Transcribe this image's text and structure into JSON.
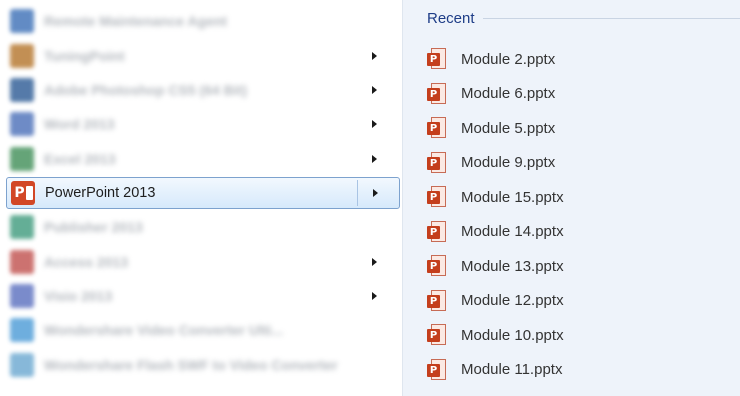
{
  "programs": [
    {
      "label": "Remote Maintenance Agent",
      "icon": "agent-icon",
      "color": "#3b6fb6",
      "has_submenu": false,
      "blurred": true
    },
    {
      "label": "TuningPoint",
      "icon": "turningpoint-icon",
      "color": "#b4742a",
      "has_submenu": true,
      "blurred": true
    },
    {
      "label": "Adobe Photoshop CS5 (64 Bit)",
      "icon": "photoshop-icon",
      "color": "#2b5a94",
      "has_submenu": true,
      "blurred": true
    },
    {
      "label": "Word 2013",
      "icon": "word-icon",
      "color": "#4a6fb8",
      "has_submenu": true,
      "blurred": true
    },
    {
      "label": "Excel 2013",
      "icon": "excel-icon",
      "color": "#3f8e57",
      "has_submenu": true,
      "blurred": true
    },
    {
      "label": "PowerPoint 2013",
      "icon": "powerpoint-icon",
      "color": "#d24726",
      "has_submenu": true,
      "blurred": false,
      "selected": true
    },
    {
      "label": "Publisher 2013",
      "icon": "publisher-icon",
      "color": "#3e9a7c",
      "has_submenu": false,
      "blurred": true
    },
    {
      "label": "Access 2013",
      "icon": "access-icon",
      "color": "#c0504d",
      "has_submenu": true,
      "blurred": true
    },
    {
      "label": "Visio 2013",
      "icon": "visio-icon",
      "color": "#5a6fbf",
      "has_submenu": true,
      "blurred": true
    },
    {
      "label": "Wondershare Video Converter Ulti...",
      "icon": "video-converter-icon",
      "color": "#4a9ad6",
      "has_submenu": false,
      "blurred": true
    },
    {
      "label": "Wondershare Flash SWF to Video Converter",
      "icon": "swf-converter-icon",
      "color": "#6aa7d0",
      "has_submenu": false,
      "blurred": true
    }
  ],
  "ppt_glyph": "P",
  "recent": {
    "header": "Recent",
    "items": [
      "Module 2.pptx",
      "Module 6.pptx",
      "Module 5.pptx",
      "Module 9.pptx",
      "Module 15.pptx",
      "Module 14.pptx",
      "Module 13.pptx",
      "Module 12.pptx",
      "Module 10.pptx",
      "Module 11.pptx"
    ]
  },
  "colors": {
    "accent_header": "#1e3d87",
    "selection_border": "#7da2ce",
    "recent_bg": "#eef3fa",
    "ppt_red": "#c43e1c"
  }
}
